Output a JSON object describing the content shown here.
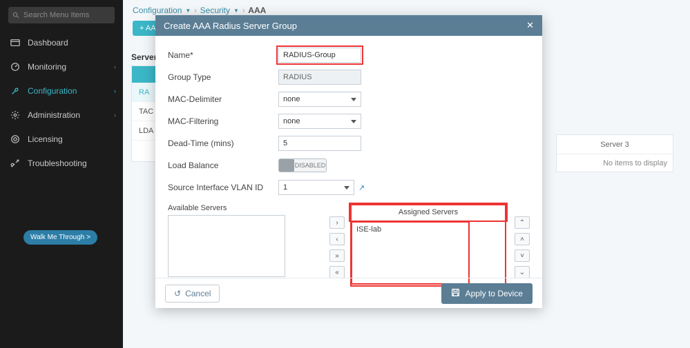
{
  "sidebar": {
    "search_placeholder": "Search Menu Items",
    "items": [
      {
        "label": "Dashboard"
      },
      {
        "label": "Monitoring"
      },
      {
        "label": "Configuration"
      },
      {
        "label": "Administration"
      },
      {
        "label": "Licensing"
      },
      {
        "label": "Troubleshooting"
      }
    ],
    "walk_label": "Walk Me Through >"
  },
  "breadcrumb": {
    "a": "Configuration",
    "b": "Security",
    "c": "AAA"
  },
  "bg": {
    "add_label": "+ AA",
    "server_heading": "Server",
    "side_rows": [
      "RA",
      "TAC",
      "LDA"
    ],
    "plus": "+",
    "server3_head": "Server 3",
    "server3_body": "No items to display"
  },
  "modal": {
    "title": "Create AAA Radius Server Group",
    "close": "✕",
    "fields": {
      "name_label": "Name*",
      "name_value": "RADIUS-Group",
      "group_type_label": "Group Type",
      "group_type_value": "RADIUS",
      "mac_delim_label": "MAC-Delimiter",
      "mac_delim_value": "none",
      "mac_filter_label": "MAC-Filtering",
      "mac_filter_value": "none",
      "dead_time_label": "Dead-Time (mins)",
      "dead_time_value": "5",
      "load_balance_label": "Load Balance",
      "load_balance_value": "DISABLED",
      "src_vlan_label": "Source Interface VLAN ID",
      "src_vlan_value": "1"
    },
    "available_caption": "Available Servers",
    "assigned_caption": "Assigned Servers",
    "assigned_items": [
      "ISE-lab"
    ],
    "move_right": "›",
    "move_left": "‹",
    "move_all_right": "»",
    "move_all_left": "«",
    "order_top": "⌃",
    "order_up": "˄",
    "order_down": "˅",
    "order_bottom": "⌄",
    "cancel": "Cancel",
    "apply": "Apply to Device"
  }
}
